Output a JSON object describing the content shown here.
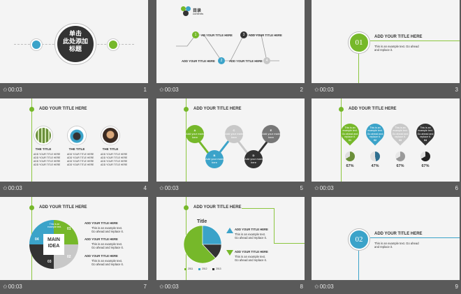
{
  "caption": {
    "star": "✩",
    "time": "00:03"
  },
  "slides": [
    {
      "number": "1",
      "title": "单击\n此处添加\n标题"
    },
    {
      "number": "2",
      "heading": "目录",
      "subheading": "contents",
      "items": [
        {
          "label": "AD YOUR TITLE HERE",
          "num": "1"
        },
        {
          "label": "ADD YOUR TITLE HERE",
          "num": "2"
        },
        {
          "label": "ADD YOUR TITLE HERE",
          "num": "3"
        },
        {
          "label": "ADD YOUR TITLE HERE",
          "num": "4"
        }
      ]
    },
    {
      "number": "3",
      "circle": "01",
      "title": "ADD YOUR TITLE HERE",
      "text": "This is an example text. Go ahead and replace it."
    },
    {
      "number": "4",
      "title": "ADD YOUR TITLE HERE",
      "cards": [
        {
          "title": "THE TITLE",
          "lines": [
            "ADD YOUR TITLE HERE",
            "ADD YOUR TITLE HERE",
            "ADD YOUR TITLE HERE",
            "ADD YOUR TITLE HERE"
          ]
        },
        {
          "title": "THE TITLE",
          "lines": [
            "ADD YOUR TITLE HERE",
            "ADD YOUR TITLE HERE",
            "ADD YOUR TITLE HERE",
            "ADD YOUR TITLE HERE"
          ]
        },
        {
          "title": "THE TITLE",
          "lines": [
            "ADD YOUR TITLE HERE",
            "ADD YOUR TITLE HERE",
            "ADD YOUR TITLE HERE",
            "ADD YOUR TITLE HERE"
          ]
        }
      ]
    },
    {
      "number": "5",
      "title": "ADD YOUR TITLE HERE",
      "bubbles": [
        {
          "letter": "A",
          "text": "Add your main here"
        },
        {
          "letter": "B",
          "text": "Add your main here"
        },
        {
          "letter": "C",
          "text": "Add your main here"
        },
        {
          "letter": "D",
          "text": "Add your main here"
        },
        {
          "letter": "E",
          "text": "Add your main here"
        }
      ]
    },
    {
      "number": "6",
      "title": "ADD YOUR TITLE HERE",
      "pins": [
        {
          "num": "01",
          "text": "This is an example text. Go ahead and replace it.",
          "pct": "67%"
        },
        {
          "num": "02",
          "text": "This is an example text. Go ahead and replace it.",
          "pct": "47%"
        },
        {
          "num": "03",
          "text": "This is an example text. Go ahead and replace it.",
          "pct": "67%"
        },
        {
          "num": "04",
          "text": "This is an example text. Go ahead and replace it.",
          "pct": "67%"
        }
      ]
    },
    {
      "number": "7",
      "title": "ADD YOUR TITLE HERE",
      "center": "MAIN\nIDEA",
      "quads": [
        "01",
        "02",
        "03",
        "04"
      ],
      "quad_text": "This is an example text.",
      "items": [
        {
          "title": "ADD YOUR TITLE HERE",
          "text": "This is an example text.\nGo ahead and replace it."
        },
        {
          "title": "ADD YOUR TITLE HERE",
          "text": "This is an example text.\nGo ahead and replace it."
        },
        {
          "title": "ADD YOUR TITLE HERE",
          "text": "This is an example text.\nGo ahead and replace it."
        }
      ]
    },
    {
      "number": "8",
      "title": "ADD YOUR TITLE HERE",
      "chart_title": "Title",
      "legend": [
        "2011",
        "2012",
        "2013"
      ],
      "items": [
        {
          "title": "ADD YOUR TITLE HERE",
          "text": "This is an example text.\nGo ahead and replace it."
        },
        {
          "title": "ADD YOUR TITLE HERE",
          "text": "This is an example text.\nGo ahead and replace it."
        }
      ]
    },
    {
      "number": "9",
      "circle": "02",
      "title": "ADD YOUR TITLE HERE",
      "text": "This is an example text. Go ahead and replace it."
    }
  ],
  "chart_data": {
    "type": "pie",
    "title": "Title",
    "categories": [
      "2011",
      "2012",
      "2013"
    ],
    "values": [
      62,
      25,
      13
    ],
    "colors": [
      "#76b82a",
      "#3ba3c9",
      "#333333"
    ]
  },
  "colors": {
    "green": "#76b82a",
    "blue": "#3ba3c9",
    "dark": "#333333",
    "gray": "#c8c8c8"
  }
}
